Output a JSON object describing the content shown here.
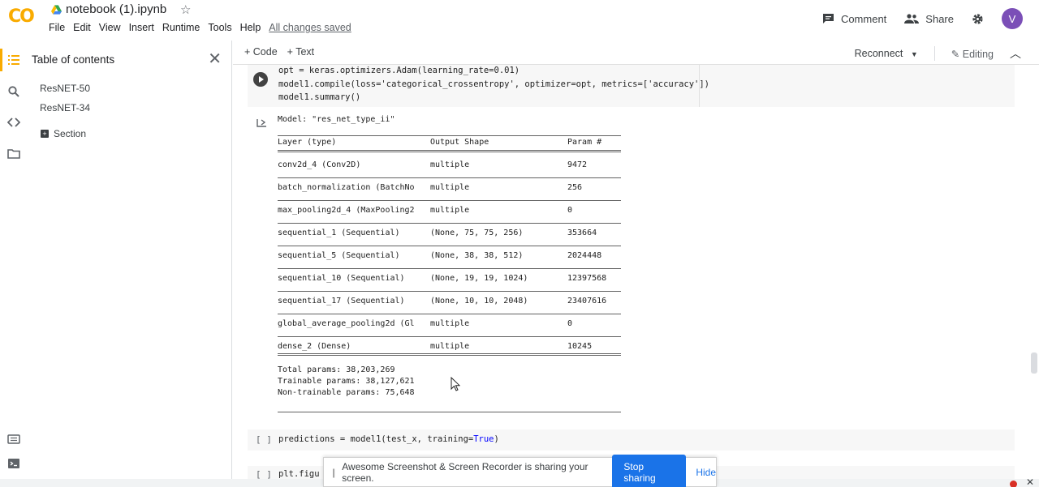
{
  "app": {
    "logo": "CO",
    "title": "notebook (1).ipynb",
    "menu": [
      "File",
      "Edit",
      "View",
      "Insert",
      "Runtime",
      "Tools",
      "Help"
    ],
    "saved_status": "All changes saved",
    "comment_label": "Comment",
    "share_label": "Share",
    "avatar_initial": "V",
    "accent": "#f9ab00"
  },
  "sidebar": {
    "title": "Table of contents",
    "items": [
      {
        "label": "ResNET-50"
      },
      {
        "label": "ResNET-34"
      },
      {
        "label": "Section"
      }
    ]
  },
  "toolbar": {
    "add_code": "+ Code",
    "add_text": "+ Text",
    "reconnect": "Reconnect",
    "editing": "Editing"
  },
  "cell1": {
    "lines": [
      "opt = keras.optimizers.Adam(learning_rate=0.01)",
      "model1.compile(loss='categorical_crossentropy', optimizer=opt, metrics=['accuracy'])",
      "model1.summary()"
    ]
  },
  "summary": {
    "model_line": "Model: \"res_net_type_ii\"",
    "header": {
      "layer": "Layer (type)",
      "shape": "Output Shape",
      "params": "Param #"
    },
    "rows": [
      {
        "layer": "conv2d_4 (Conv2D)",
        "shape": "multiple",
        "params": "9472"
      },
      {
        "layer": "batch_normalization (BatchNo",
        "shape": "multiple",
        "params": "256"
      },
      {
        "layer": "max_pooling2d_4 (MaxPooling2",
        "shape": "multiple",
        "params": "0"
      },
      {
        "layer": "sequential_1 (Sequential)",
        "shape": "(None, 75, 75, 256)",
        "params": "353664"
      },
      {
        "layer": "sequential_5 (Sequential)",
        "shape": "(None, 38, 38, 512)",
        "params": "2024448"
      },
      {
        "layer": "sequential_10 (Sequential)",
        "shape": "(None, 19, 19, 1024)",
        "params": "12397568"
      },
      {
        "layer": "sequential_17 (Sequential)",
        "shape": "(None, 10, 10, 2048)",
        "params": "23407616"
      },
      {
        "layer": "global_average_pooling2d (Gl",
        "shape": "multiple",
        "params": "0"
      },
      {
        "layer": "dense_2 (Dense)",
        "shape": "multiple",
        "params": "10245"
      }
    ],
    "total": "Total params: 38,203,269",
    "trainable": "Trainable params: 38,127,621",
    "non_trainable": "Non-trainable params: 75,648"
  },
  "cell2": {
    "brackets": "[ ]",
    "code_pre": "predictions = model1(test_x, training=",
    "code_kw": "True",
    "code_post": ")"
  },
  "cell3": {
    "brackets": "[ ]",
    "code": "plt.figu"
  },
  "banner": {
    "message": "Awesome Screenshot & Screen Recorder is sharing your screen.",
    "stop": "Stop sharing",
    "hide": "Hide"
  }
}
